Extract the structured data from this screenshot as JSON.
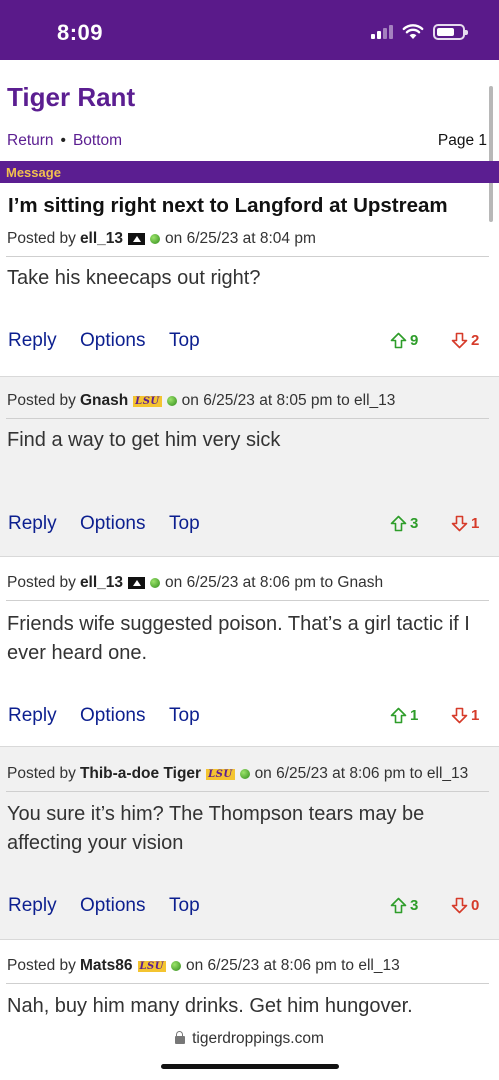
{
  "status_bar": {
    "time": "8:09",
    "icons": [
      "cellular-signal-icon",
      "wifi-icon",
      "battery-icon"
    ],
    "background_color": "#5a1a8a"
  },
  "header": {
    "board_title": "Tiger Rant",
    "nav": {
      "return_label": "Return",
      "separator": "•",
      "bottom_label": "Bottom"
    },
    "page_label": "Page 1"
  },
  "message_bar": {
    "label": "Message"
  },
  "thread": {
    "title": "I’m sitting right next to Langford at Upstream"
  },
  "posts": [
    {
      "posted_by_label": "Posted by",
      "author": "ell_13",
      "author_badge": "rank-icon",
      "date_text": "on 6/25/23 at 8:04 pm",
      "body": "Take his kneecaps out right?",
      "actions": {
        "reply": "Reply",
        "options": "Options",
        "top": "Top"
      },
      "votes": {
        "up": "9",
        "down": "2"
      }
    },
    {
      "posted_by_label": "Posted by",
      "author": "Gnash",
      "author_badge": "LSU",
      "date_text": "on 6/25/23 at 8:05 pm to ell_13",
      "body": "Find a way to get him very sick",
      "actions": {
        "reply": "Reply",
        "options": "Options",
        "top": "Top"
      },
      "votes": {
        "up": "3",
        "down": "1"
      }
    },
    {
      "posted_by_label": "Posted by",
      "author": "ell_13",
      "author_badge": "rank-icon",
      "date_text": "on 6/25/23 at 8:06 pm to Gnash",
      "body": "Friends wife suggested poison. That’s a girl tactic if I ever heard one.",
      "actions": {
        "reply": "Reply",
        "options": "Options",
        "top": "Top"
      },
      "votes": {
        "up": "1",
        "down": "1"
      }
    },
    {
      "posted_by_label": "Posted by",
      "author": "Thib-a-doe Tiger",
      "author_badge": "LSU",
      "date_text": "on 6/25/23 at 8:06 pm to ell_13",
      "body": "You sure it’s him? The Thompson tears may be affecting your vision",
      "actions": {
        "reply": "Reply",
        "options": "Options",
        "top": "Top"
      },
      "votes": {
        "up": "3",
        "down": "0"
      }
    },
    {
      "posted_by_label": "Posted by",
      "author": "Mats86",
      "author_badge": "LSU",
      "date_text": "on 6/25/23 at 8:06 pm to ell_13",
      "body": "Nah, buy him many drinks. Get him hungover."
    }
  ],
  "browser": {
    "url": "tigerdroppings.com"
  },
  "colors": {
    "brand_purple": "#5b1e91",
    "link_blue": "#0c1f8f",
    "upvote_green": "#2e9d2a",
    "downvote_red": "#d63b2a",
    "message_gold": "#f2c14e"
  }
}
